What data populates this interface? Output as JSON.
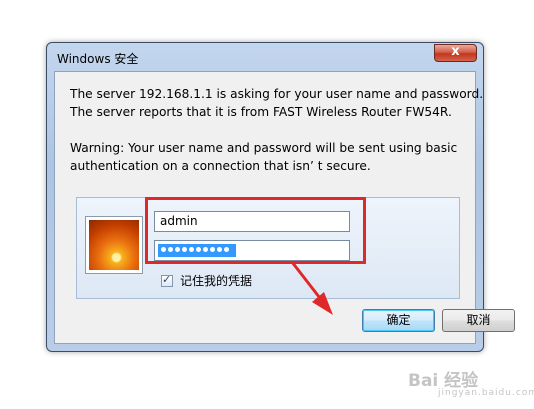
{
  "window": {
    "title": "Windows 安全",
    "close_label": "x"
  },
  "message": {
    "line1": "The server 192.168.1.1 is asking for your user name and password.",
    "line2": "The server reports that it is from FAST Wireless Router FW54R.",
    "line3": "Warning: Your user name and password will be sent using basic",
    "line4": "authentication on a connection that isn’ t secure."
  },
  "credentials": {
    "username": "admin",
    "password_mask_count": 10,
    "remember_label": "记住我的凭据",
    "remember_checked": true
  },
  "buttons": {
    "ok_label": "确定",
    "cancel_label": "取消"
  },
  "annotation": {
    "color": "#e0282a"
  },
  "watermark": {
    "text": "Bai 经验",
    "sub": "jingyan.baidu.com"
  }
}
